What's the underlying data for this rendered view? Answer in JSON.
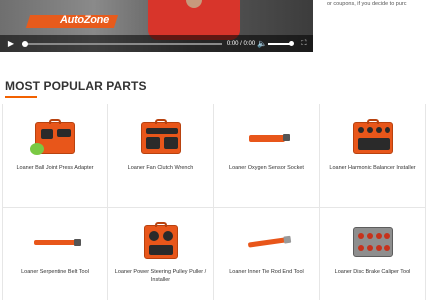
{
  "video": {
    "logo_text": "AutoZone",
    "time": "0:00 / 0:00",
    "progress": 0,
    "icons": {
      "play": "play-icon",
      "volume": "volume-icon",
      "fullscreen": "fullscreen-icon"
    }
  },
  "side_text": "or coupons, if you decide to purc",
  "section": {
    "title": "MOST POPULAR PARTS"
  },
  "products": [
    {
      "name": "Loaner Ball Joint Press Adapter"
    },
    {
      "name": "Loaner Fan Clutch Wrench"
    },
    {
      "name": "Loaner Oxygen Sensor Socket"
    },
    {
      "name": "Loaner Harmonic Balancer Installer"
    },
    {
      "name": "Loaner Serpentine Belt Tool"
    },
    {
      "name": "Loaner Power Steering Pulley Puller / Installer"
    },
    {
      "name": "Loaner Inner Tie Rod End Tool"
    },
    {
      "name": "Loaner Disc Brake Caliper Tool"
    }
  ],
  "colors": {
    "accent": "#f26100",
    "tool_orange": "#e8561a",
    "text": "#333333",
    "border": "#e6e6e6"
  }
}
